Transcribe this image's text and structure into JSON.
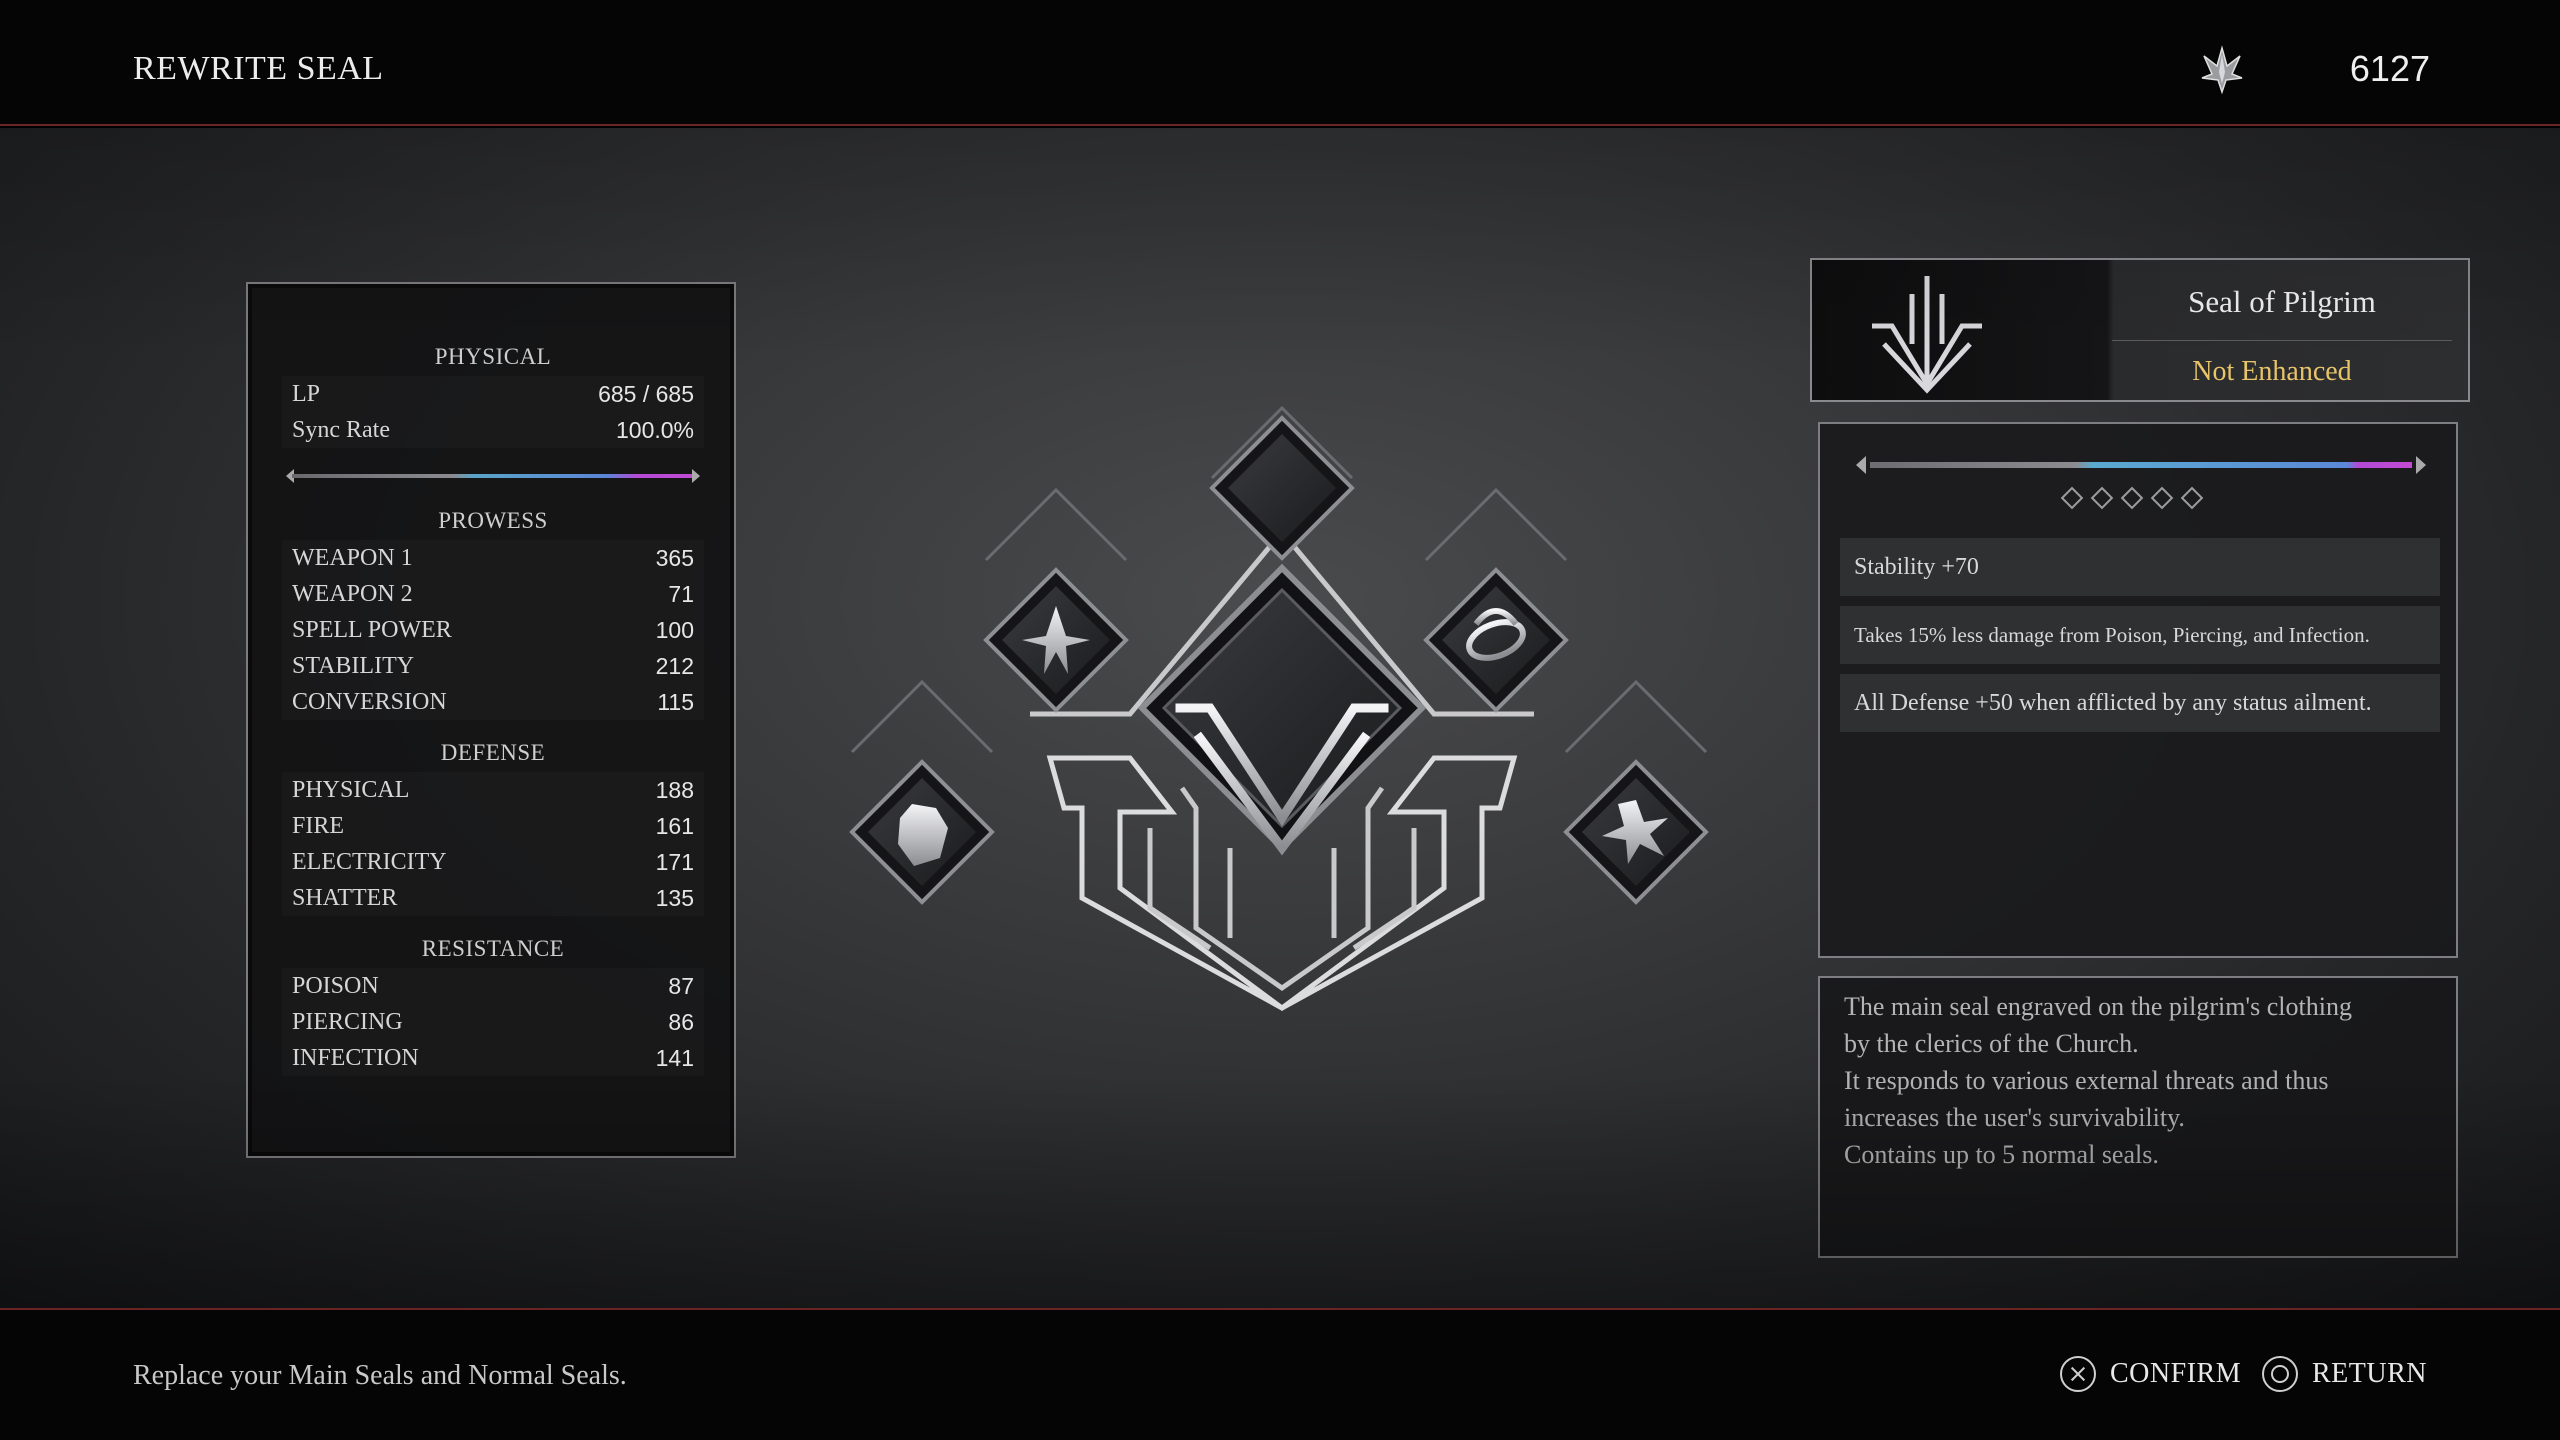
{
  "header": {
    "title": "REWRITE SEAL",
    "currency_icon": "crystal-shard-icon",
    "currency_value": "6127"
  },
  "stats": {
    "physical_head": "PHYSICAL",
    "lp": {
      "label": "LP",
      "value": "685 / 685"
    },
    "sync": {
      "label": "Sync Rate",
      "value": "100.0%"
    },
    "prowess_head": "PROWESS",
    "prowess": [
      {
        "label": "WEAPON 1",
        "value": "365"
      },
      {
        "label": "WEAPON 2",
        "value": "71"
      },
      {
        "label": "SPELL POWER",
        "value": "100"
      },
      {
        "label": "STABILITY",
        "value": "212"
      },
      {
        "label": "CONVERSION",
        "value": "115"
      }
    ],
    "defense_head": "DEFENSE",
    "defense": [
      {
        "label": "PHYSICAL",
        "value": "188"
      },
      {
        "label": "FIRE",
        "value": "161"
      },
      {
        "label": "ELECTRICITY",
        "value": "171"
      },
      {
        "label": "SHATTER",
        "value": "135"
      }
    ],
    "resistance_head": "RESISTANCE",
    "resistance": [
      {
        "label": "POISON",
        "value": "87"
      },
      {
        "label": "PIERCING",
        "value": "86"
      },
      {
        "label": "INFECTION",
        "value": "141"
      }
    ]
  },
  "seal": {
    "name": "Seal of Pilgrim",
    "status": "Not Enhanced",
    "status_color": "#e8c46a",
    "enhance_level": 0,
    "enhance_max": 5,
    "effects": [
      "Stability +70",
      "Takes 15% less damage from Poison, Piercing, and Infection.",
      "All Defense +50 when afflicted by any status ailment."
    ],
    "description": [
      "The main seal engraved on the pilgrim's clothing",
      "by the clerics of the Church.",
      "It responds to various external threats and thus",
      "increases the user's survivability.",
      "Contains up to 5 normal seals."
    ]
  },
  "footer": {
    "hint": "Replace your Main Seals and Normal Seals.",
    "confirm": "CONFIRM",
    "return": "RETURN"
  },
  "accent_color": "#6a2424"
}
